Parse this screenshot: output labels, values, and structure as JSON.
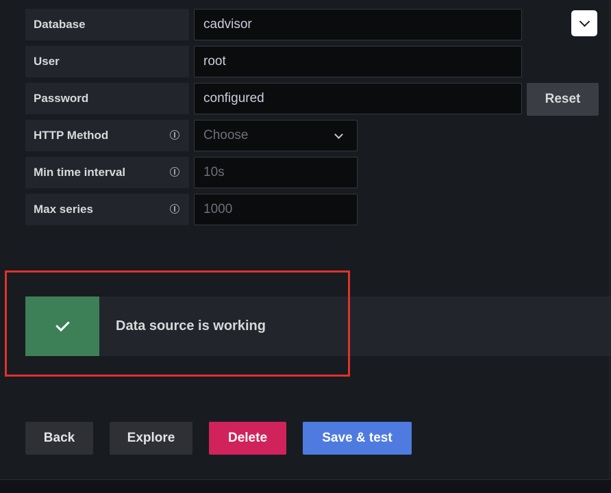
{
  "fields": [
    {
      "label": "Database",
      "value": "cadvisor",
      "info": false,
      "kind": "text"
    },
    {
      "label": "User",
      "value": "root",
      "info": false,
      "kind": "text"
    },
    {
      "label": "Password",
      "value": "configured",
      "info": false,
      "kind": "text"
    },
    {
      "label": "HTTP Method",
      "placeholder": "Choose",
      "info": true,
      "kind": "select"
    },
    {
      "label": "Min time interval",
      "placeholder": "10s",
      "info": true,
      "kind": "text"
    },
    {
      "label": "Max series",
      "placeholder": "1000",
      "info": true,
      "kind": "text"
    }
  ],
  "password_reset_label": "Reset",
  "alert": {
    "message": "Data source is working",
    "status": "success",
    "icon": "check-icon",
    "color": "#3d8057"
  },
  "actions": {
    "back": "Back",
    "explore": "Explore",
    "delete": "Delete",
    "save_test": "Save & test"
  },
  "colors": {
    "delete": "#d1235b",
    "save": "#4f7be0",
    "highlight": "#e0322d"
  }
}
